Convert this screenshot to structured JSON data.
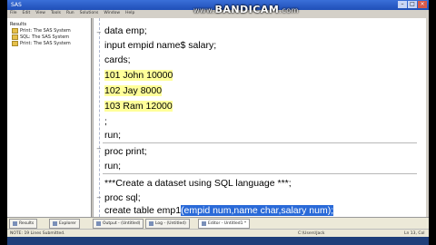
{
  "window": {
    "title": "SAS",
    "controls": {
      "minimize": "–",
      "maximize": "□",
      "close": "×"
    }
  },
  "menu": [
    "File",
    "Edit",
    "View",
    "Tools",
    "Run",
    "Solutions",
    "Window",
    "Help"
  ],
  "recorder": {
    "prefix": "www.",
    "brand": "BANDICAM",
    "suffix": ".com"
  },
  "explorer": {
    "root": "Results",
    "items": [
      "Print:  The SAS System",
      "SQL:  The SAS System",
      "Print:  The SAS System"
    ]
  },
  "editor": {
    "lines": [
      "data emp;",
      "input empid name$ salary;",
      "cards;",
      "101 John 10000",
      "102 Jay 8000",
      "103 Ram 12000",
      ";",
      "run;",
      "proc print;",
      "run;",
      "***Create a dataset using SQL language ***;",
      "proc sql;",
      "create table emp1",
      "(empid num,name char,salary num);"
    ]
  },
  "tabs": [
    "Results",
    "Explorer",
    "Output - (Untitled)",
    "Log - (Untitled)",
    "Editor - Untitled1 *"
  ],
  "status": {
    "left": "NOTE: 19 Lines Submitted.",
    "middle": "C:\\Users\\Jack",
    "right": "Ln 13, Col 33"
  },
  "colors": {
    "selection": "#2a6ad8",
    "datalines_highlight": "#ffff99",
    "titlebar": "#1f4fb8"
  }
}
